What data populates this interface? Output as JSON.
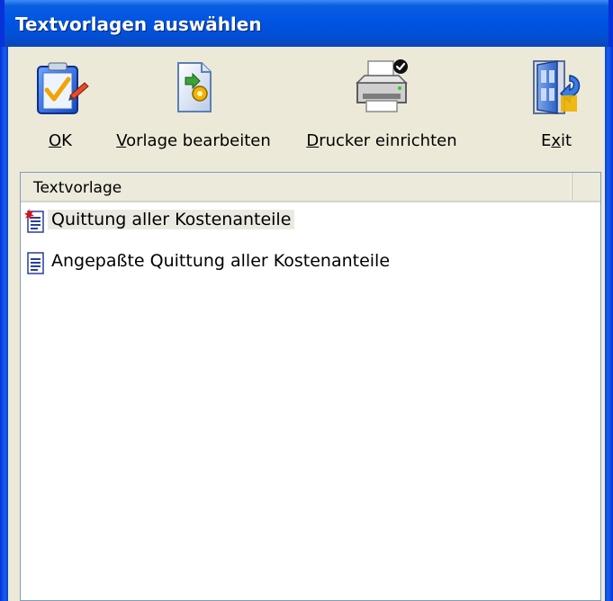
{
  "window": {
    "title": "Textvorlagen auswählen"
  },
  "toolbar": {
    "ok": {
      "prefix": "",
      "mnemonic": "O",
      "suffix": "K",
      "icon": "ok-checkmark-icon"
    },
    "edit": {
      "prefix": "",
      "mnemonic": "V",
      "suffix": "orlage bearbeiten",
      "icon": "edit-template-icon"
    },
    "printer": {
      "prefix": "",
      "mnemonic": "D",
      "suffix": "rucker einrichten",
      "icon": "printer-setup-icon"
    },
    "exit": {
      "prefix": "E",
      "mnemonic": "x",
      "suffix": "it",
      "icon": "exit-door-icon"
    }
  },
  "list": {
    "column_header": "Textvorlage",
    "items": [
      {
        "label": "Quittung aller Kostenanteile",
        "icon": "default-document-icon",
        "selected": true
      },
      {
        "label": "Angepaßte Quittung aller Kostenanteile",
        "icon": "document-icon",
        "selected": false
      }
    ]
  },
  "colors": {
    "titlebar": "#0054e3",
    "frame": "#0831d9",
    "face": "#ece9d8",
    "list_bg": "#ffffff"
  }
}
